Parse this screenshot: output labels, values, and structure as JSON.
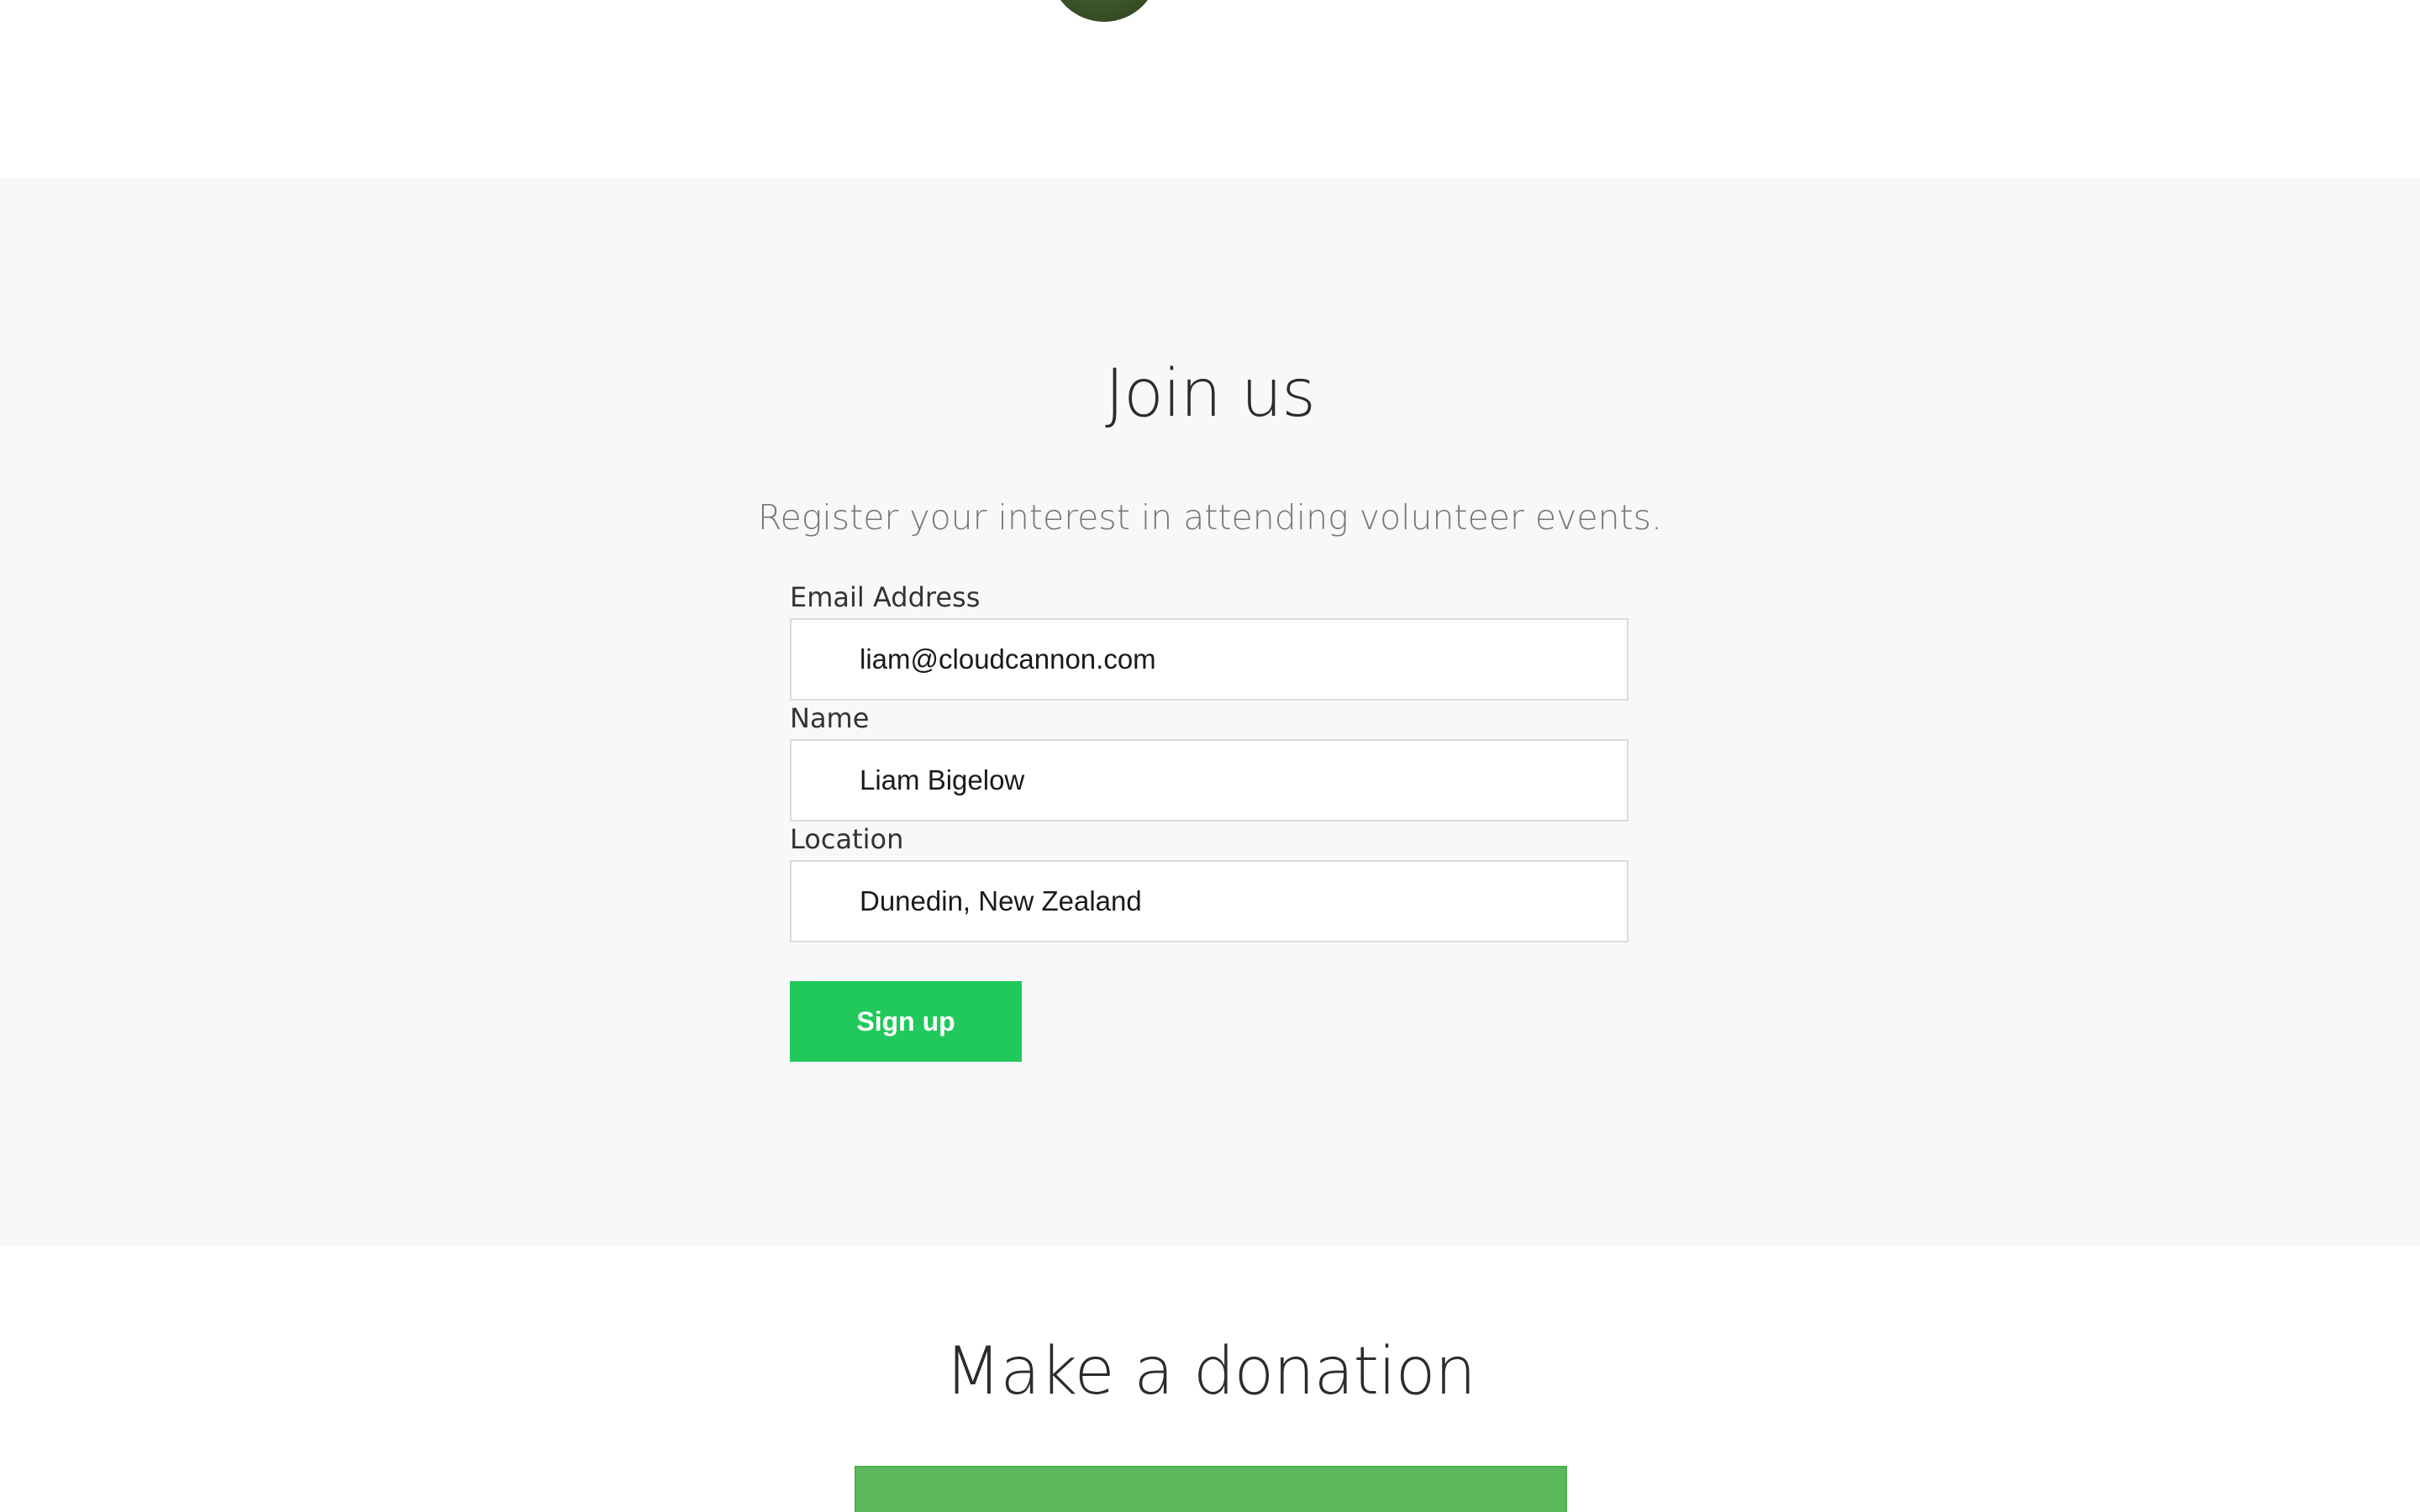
{
  "join": {
    "title": "Join us",
    "subtitle": "Register your interest in attending volunteer events.",
    "fields": [
      {
        "label": "Email Address",
        "value": "liam@cloudcannon.com"
      },
      {
        "label": "Name",
        "value": "Liam Bigelow"
      },
      {
        "label": "Location",
        "value": "Dunedin, New Zealand"
      }
    ],
    "submit_label": "Sign up"
  },
  "donation": {
    "title": "Make a donation"
  },
  "colors": {
    "section_bg": "#f7f8f9",
    "button_green": "#21c85b",
    "donation_green": "#5cb85c",
    "title_text": "#2c2c2c",
    "subtitle_text": "#777777"
  }
}
